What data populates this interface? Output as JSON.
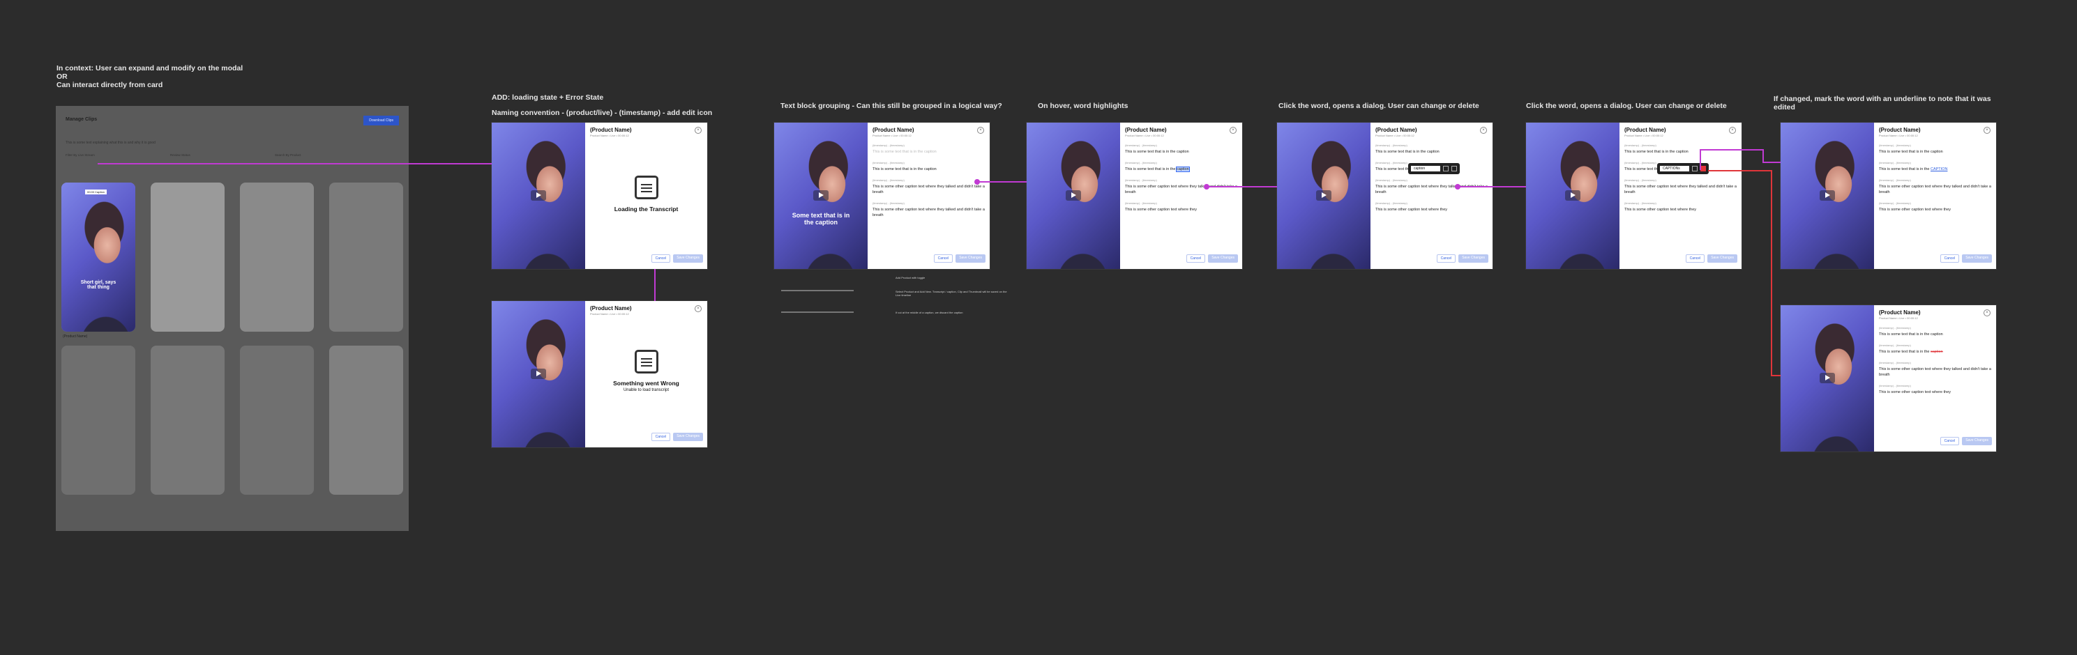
{
  "notes": {
    "n1": "In context: User can expand and modify on the modal\nOR\nCan interact directly from card",
    "n2": "ADD: loading state + Error State",
    "n3": "Naming convention - (product/live) - (timestamp) - add edit icon",
    "n4": "Text block grouping - Can this still be grouped in a logical way?",
    "n5": "On hover, word highlights",
    "n6": "Click the word, opens a dialog. User can change or delete",
    "n7": "Click the word, opens a dialog. User can change or delete",
    "n8": "If changed, mark the word with an underline to note that it was\nedited"
  },
  "modal": {
    "product_name": "(Product Name)",
    "subtitle": "Product Name • Live • 00:00:12",
    "cancel": "Cancel",
    "save": "Save Changes",
    "loading": "Loading the Transcript",
    "error_title": "Something went Wrong",
    "error_sub": "Unable to load transcript",
    "ts": "(timestamp) - (timestamp)",
    "cap1": "This is some text that is in the caption",
    "cap2": "This is some other caption text where they talked and didn't take a breath",
    "cap3": "This is some other caption text where they",
    "cap1_pre": "This is some text that is in the",
    "cap1_word": "caption",
    "cap1_edited": "CAPTION",
    "overlay_caption": "Some text that is in the caption",
    "popover_value1": "caption",
    "popover_value2": "CAPTIONs"
  },
  "grid": {
    "title": "Manage Clips",
    "desc": "This is some text explaining what this is and why it is good",
    "filter1": "Filter By Live Stream",
    "filter2": "Review Status",
    "filter3": "Search By Product",
    "action": "Download Clips",
    "card_name": "(Product Name)",
    "card_caption": "Short girl, says that thing",
    "chip": "00:00 Caption"
  },
  "mini": {
    "m1": "Add Product with toggle",
    "m2": "Select Product and Add New. Transcript / caption, Clip and Thumbnail will be saved on the Live timeline",
    "m3": "If cut at the middle of a caption, we discard the caption"
  }
}
